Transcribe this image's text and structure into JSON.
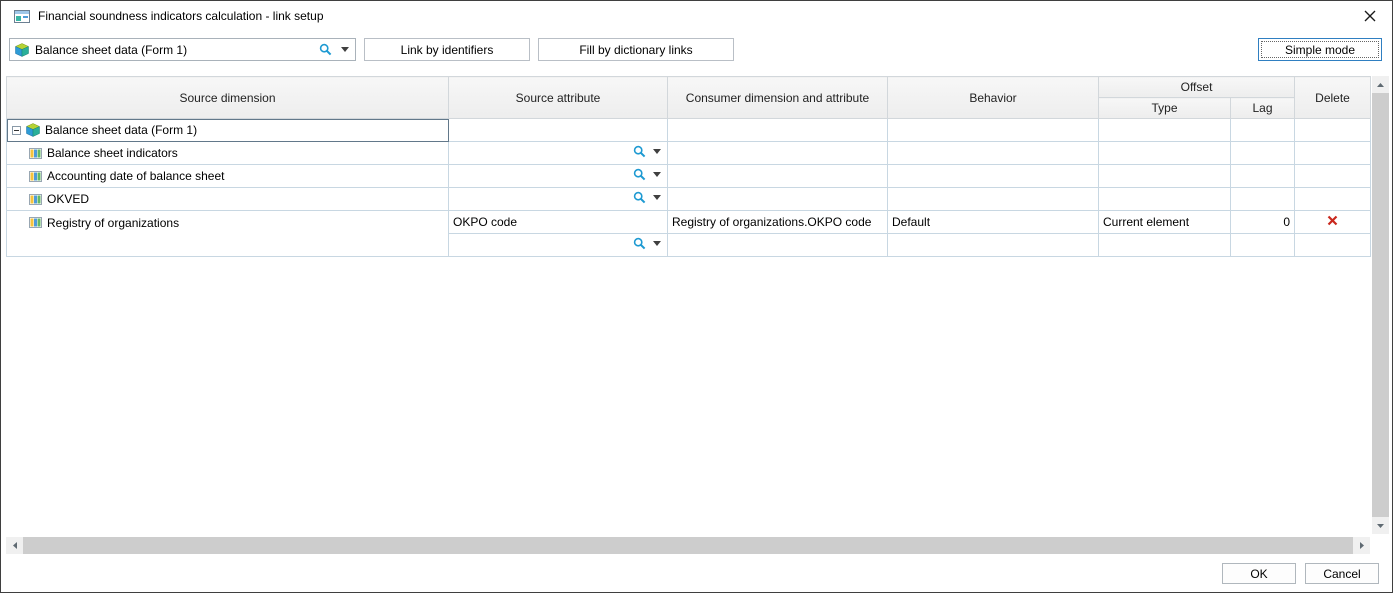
{
  "window": {
    "title": "Financial soundness indicators calculation - link setup"
  },
  "toolbar": {
    "source_combo": {
      "value": "Balance sheet data (Form 1)"
    },
    "link_by_identifiers_label": "Link by identifiers",
    "fill_by_dictionary_links_label": "Fill by dictionary links",
    "simple_mode_label": "Simple mode"
  },
  "table": {
    "headers": {
      "source_dimension": "Source dimension",
      "source_attribute": "Source attribute",
      "consumer": "Consumer dimension and attribute",
      "behavior": "Behavior",
      "offset": "Offset",
      "offset_type": "Type",
      "offset_lag": "Lag",
      "delete": "Delete"
    },
    "rows": [
      {
        "label": "Balance sheet data (Form 1)"
      },
      {
        "label": "Balance sheet indicators"
      },
      {
        "label": "Accounting date of balance sheet"
      },
      {
        "label": "OKVED"
      },
      {
        "label": "Registry of organizations",
        "source_attribute": "OKPO code",
        "consumer": "Registry of organizations.OKPO code",
        "behavior": "Default",
        "offset_type": "Current element",
        "offset_lag": "0"
      }
    ]
  },
  "footer": {
    "ok_label": "OK",
    "cancel_label": "Cancel"
  }
}
